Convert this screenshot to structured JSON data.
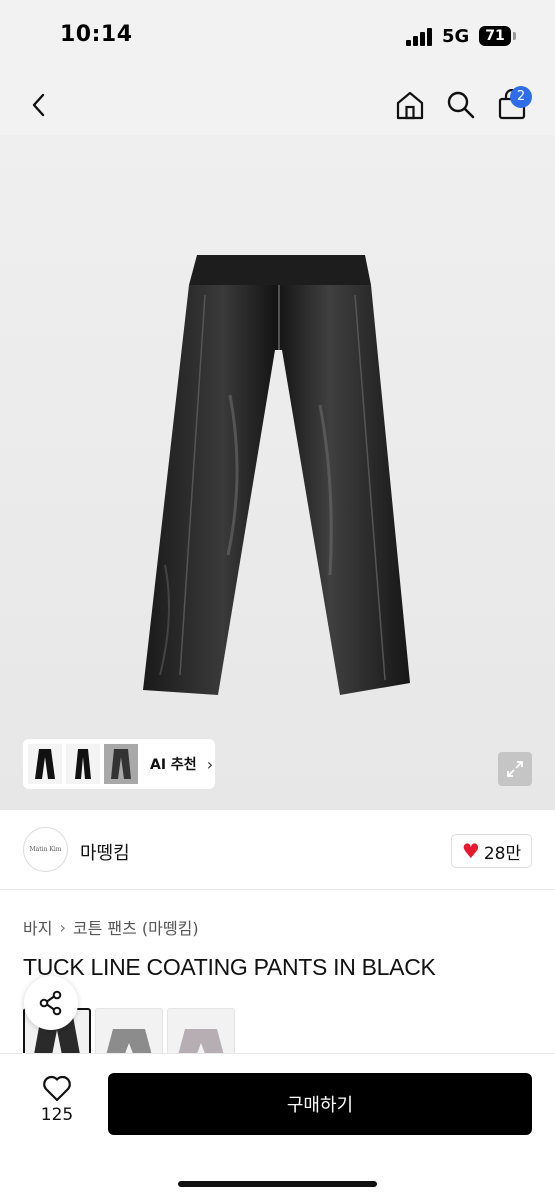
{
  "status_bar": {
    "time": "10:14",
    "network": "5G",
    "battery": "71"
  },
  "nav": {
    "back_icon": "chevron-left-icon",
    "home_icon": "home-icon",
    "search_icon": "search-icon",
    "bag_icon": "shopping-bag-icon",
    "bag_count": "2"
  },
  "gallery": {
    "ai_recommend_label": "AI 추천",
    "expand_icon": "expand-icon"
  },
  "brand": {
    "logo_text": "Matin Kim",
    "name": "마뗑킴",
    "likes": "28만"
  },
  "breadcrumb": {
    "category": "바지",
    "subcategory": "코튼 팬츠 (마뗑킴)"
  },
  "product": {
    "title": "TUCK LINE COATING PANTS IN BLACK"
  },
  "bottom_bar": {
    "wish_count": "125",
    "buy_label": "구매하기"
  },
  "colors": {
    "accent_badge": "#2f6dea",
    "heart": "#e6192e",
    "buy_button": "#000000"
  }
}
